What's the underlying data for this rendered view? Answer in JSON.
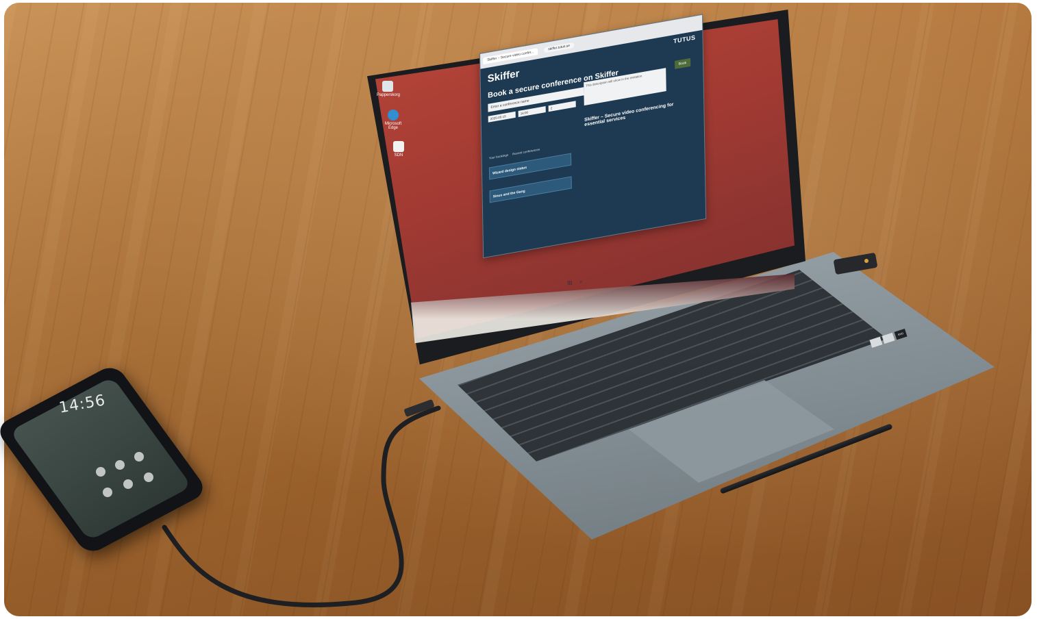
{
  "browser": {
    "tab_title": "Skiffer – Secure video confer...",
    "url": "skiffer.tutus.se"
  },
  "page": {
    "brand": "Skiffer",
    "partner_logo": "TUTUS",
    "headline": "Book a secure conference on Skiffer",
    "name_placeholder": "Enter a conference name",
    "description_placeholder": "This description will show in the invitation",
    "date_value": "2025-05-15",
    "time_value": "16:00",
    "duration_value": "2",
    "submit_label": "Book",
    "promo_title": "Skiffer – Secure video conferencing for essential services",
    "tabs": [
      "Your bookings",
      "Recent conferences"
    ],
    "cards": [
      {
        "title": "Wizard design status",
        "icon": "refresh-icon"
      },
      {
        "title": "Sinus and the Gang",
        "icon": "refresh-icon"
      }
    ]
  },
  "desktop": {
    "icons": [
      "Papperskorg",
      "Microsoft Edge",
      "SDN"
    ]
  },
  "phone": {
    "time": "14:56"
  },
  "laptop": {
    "sticker_label": "evo"
  },
  "colors": {
    "screen_wallpaper": "#a33b33",
    "browser_bg": "#1d3a52",
    "submit_button": "#4f6b3a",
    "table_wood": "#b67a3f"
  }
}
